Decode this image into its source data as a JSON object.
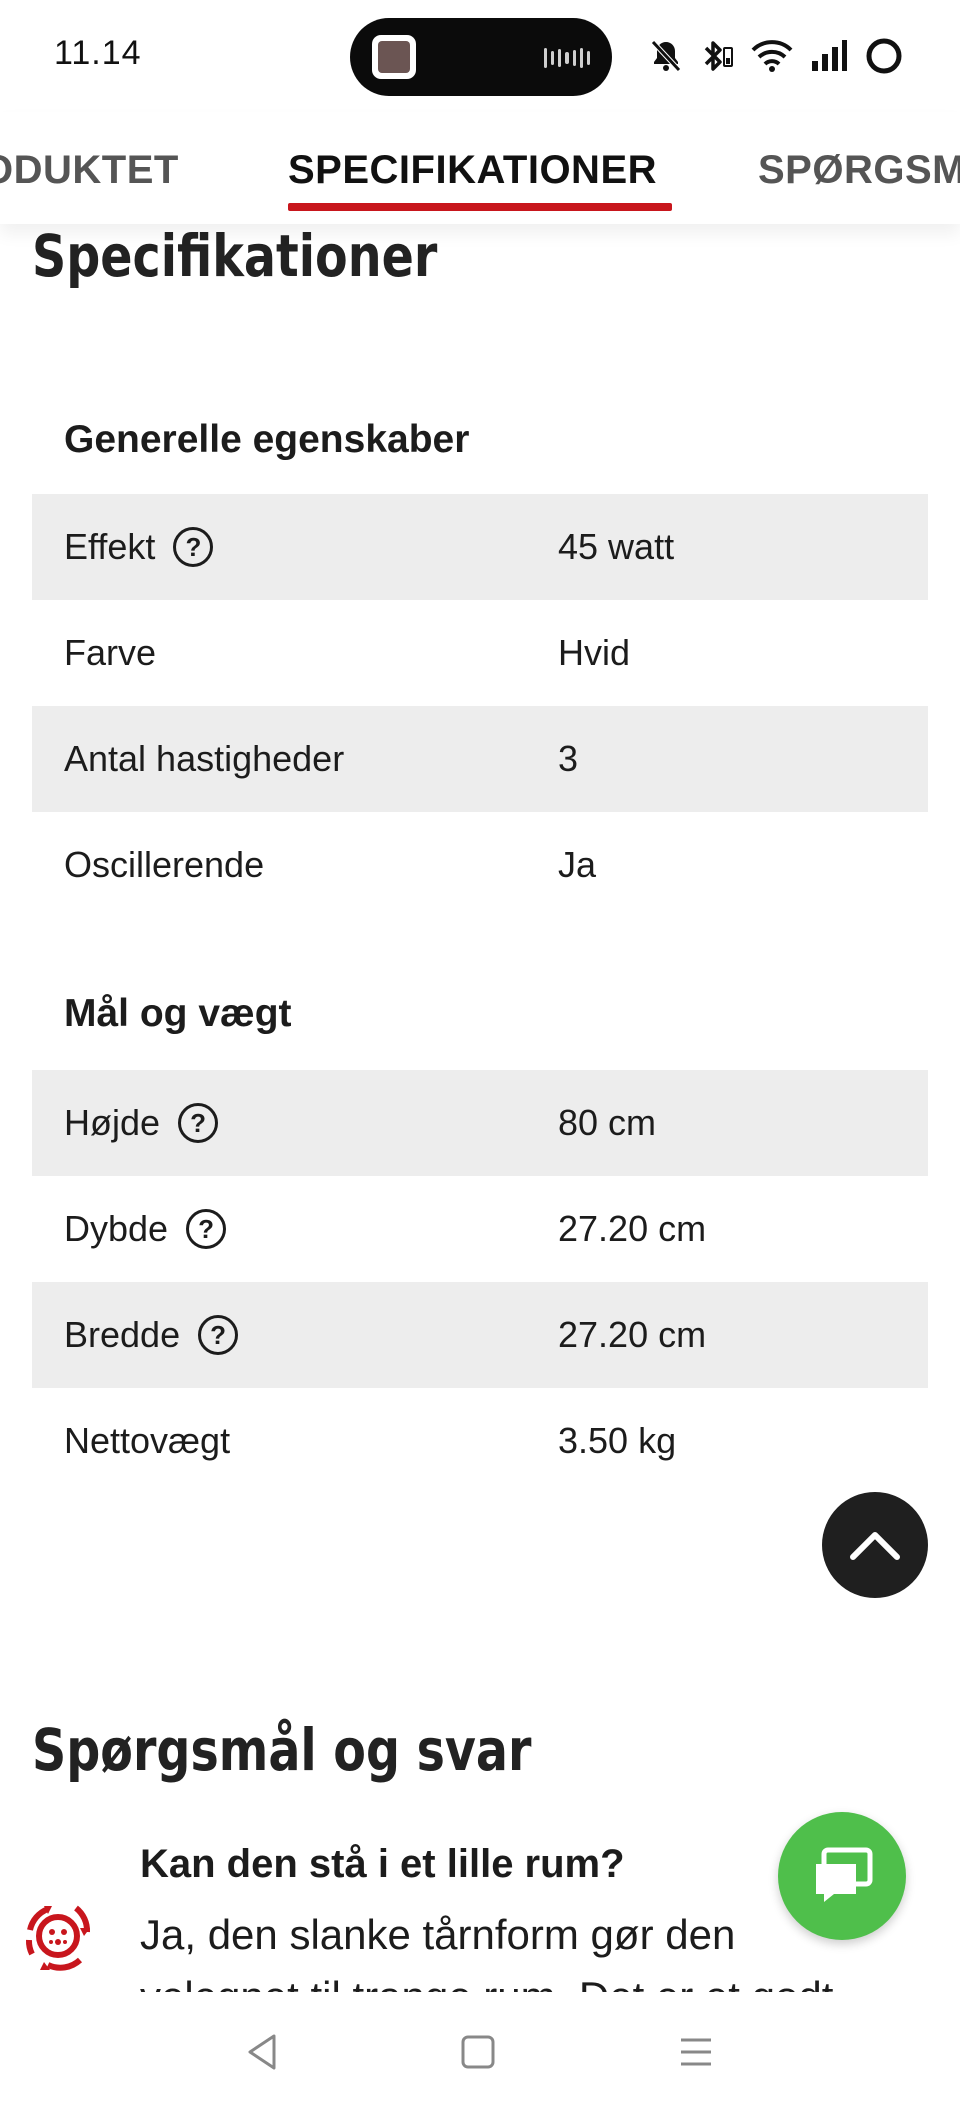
{
  "status_bar": {
    "time": "11.14",
    "icons": [
      "media-thumbnail-icon",
      "audio-wave-icon",
      "bell-muted-icon",
      "bluetooth-icon",
      "wifi-icon",
      "signal-icon",
      "battery-ring-icon"
    ]
  },
  "tabs": [
    {
      "label": "ODUKTET",
      "active": false
    },
    {
      "label": "SPECIFIKATIONER",
      "active": true
    },
    {
      "label": "SPØRGSM",
      "active": false
    }
  ],
  "accent_color": "#c8161d",
  "page_heading": "Specifikationer",
  "spec_sections": [
    {
      "title": "Generelle egenskaber",
      "rows": [
        {
          "label": "Effekt",
          "value": "45 watt",
          "help": true
        },
        {
          "label": "Farve",
          "value": "Hvid",
          "help": false
        },
        {
          "label": "Antal hastigheder",
          "value": "3",
          "help": false
        },
        {
          "label": "Oscillerende",
          "value": "Ja",
          "help": false
        }
      ]
    },
    {
      "title": "Mål og vægt",
      "rows": [
        {
          "label": "Højde",
          "value": "80 cm",
          "help": true
        },
        {
          "label": "Dybde",
          "value": "27.20 cm",
          "help": true
        },
        {
          "label": "Bredde",
          "value": "27.20 cm",
          "help": true
        },
        {
          "label": "Nettovægt",
          "value": "3.50 kg",
          "help": false
        }
      ]
    }
  ],
  "help_symbol": "?",
  "qa": {
    "heading": "Spørgsmål og svar",
    "question": "Kan den stå i et lille rum?",
    "answer": "Ja, den slanke tårnform gør den velegnet til trange rum. Det er et godt"
  },
  "chat_button_color": "#4fbf4b",
  "nav_bar": [
    "back-icon",
    "home-icon",
    "menu-icon"
  ]
}
